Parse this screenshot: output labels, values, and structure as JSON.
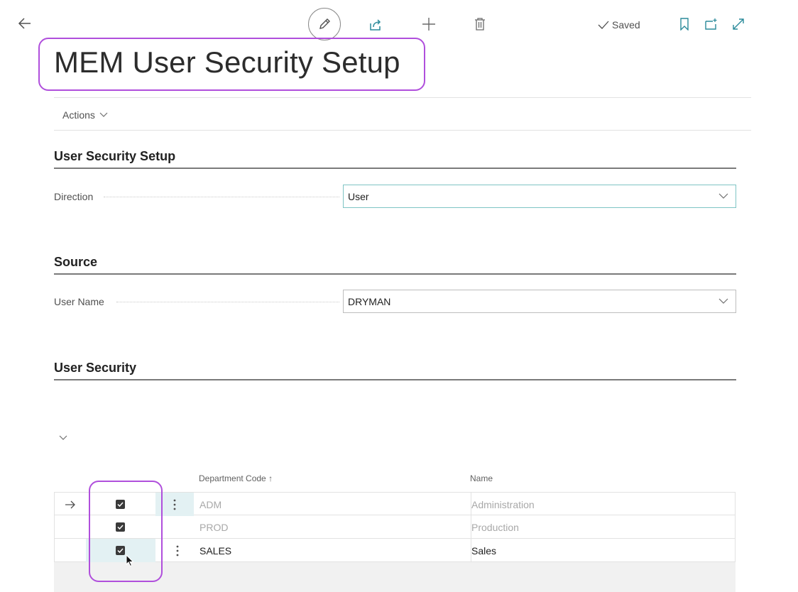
{
  "toolbar": {
    "saved_label": "Saved"
  },
  "page": {
    "title": "MEM User Security Setup",
    "actions_label": "Actions"
  },
  "sections": {
    "setup": {
      "title": "User Security Setup",
      "direction_label": "Direction",
      "direction_value": "User"
    },
    "source": {
      "title": "Source",
      "username_label": "User Name",
      "username_value": "DRYMAN"
    },
    "security": {
      "title": "User Security"
    }
  },
  "table": {
    "columns": [
      "Department Code",
      "Name"
    ],
    "sort_indicator": "↑",
    "rows": [
      {
        "code": "ADM",
        "name": "Administration",
        "checked": true
      },
      {
        "code": "PROD",
        "name": "Production",
        "checked": true
      },
      {
        "code": "SALES",
        "name": "Sales",
        "checked": true
      }
    ]
  },
  "colors": {
    "accent_highlight": "#b04fdc",
    "focus_border": "#7ec4c4",
    "selected_row": "#e3f1f3"
  },
  "icons": [
    "back-arrow-icon",
    "edit-icon",
    "share-icon",
    "plus-icon",
    "delete-icon",
    "check-icon",
    "bookmark-icon",
    "open-new-window-icon",
    "expand-icon",
    "chevron-down-icon",
    "row-arrow-icon",
    "more-options-icon",
    "mouse-cursor-icon"
  ]
}
